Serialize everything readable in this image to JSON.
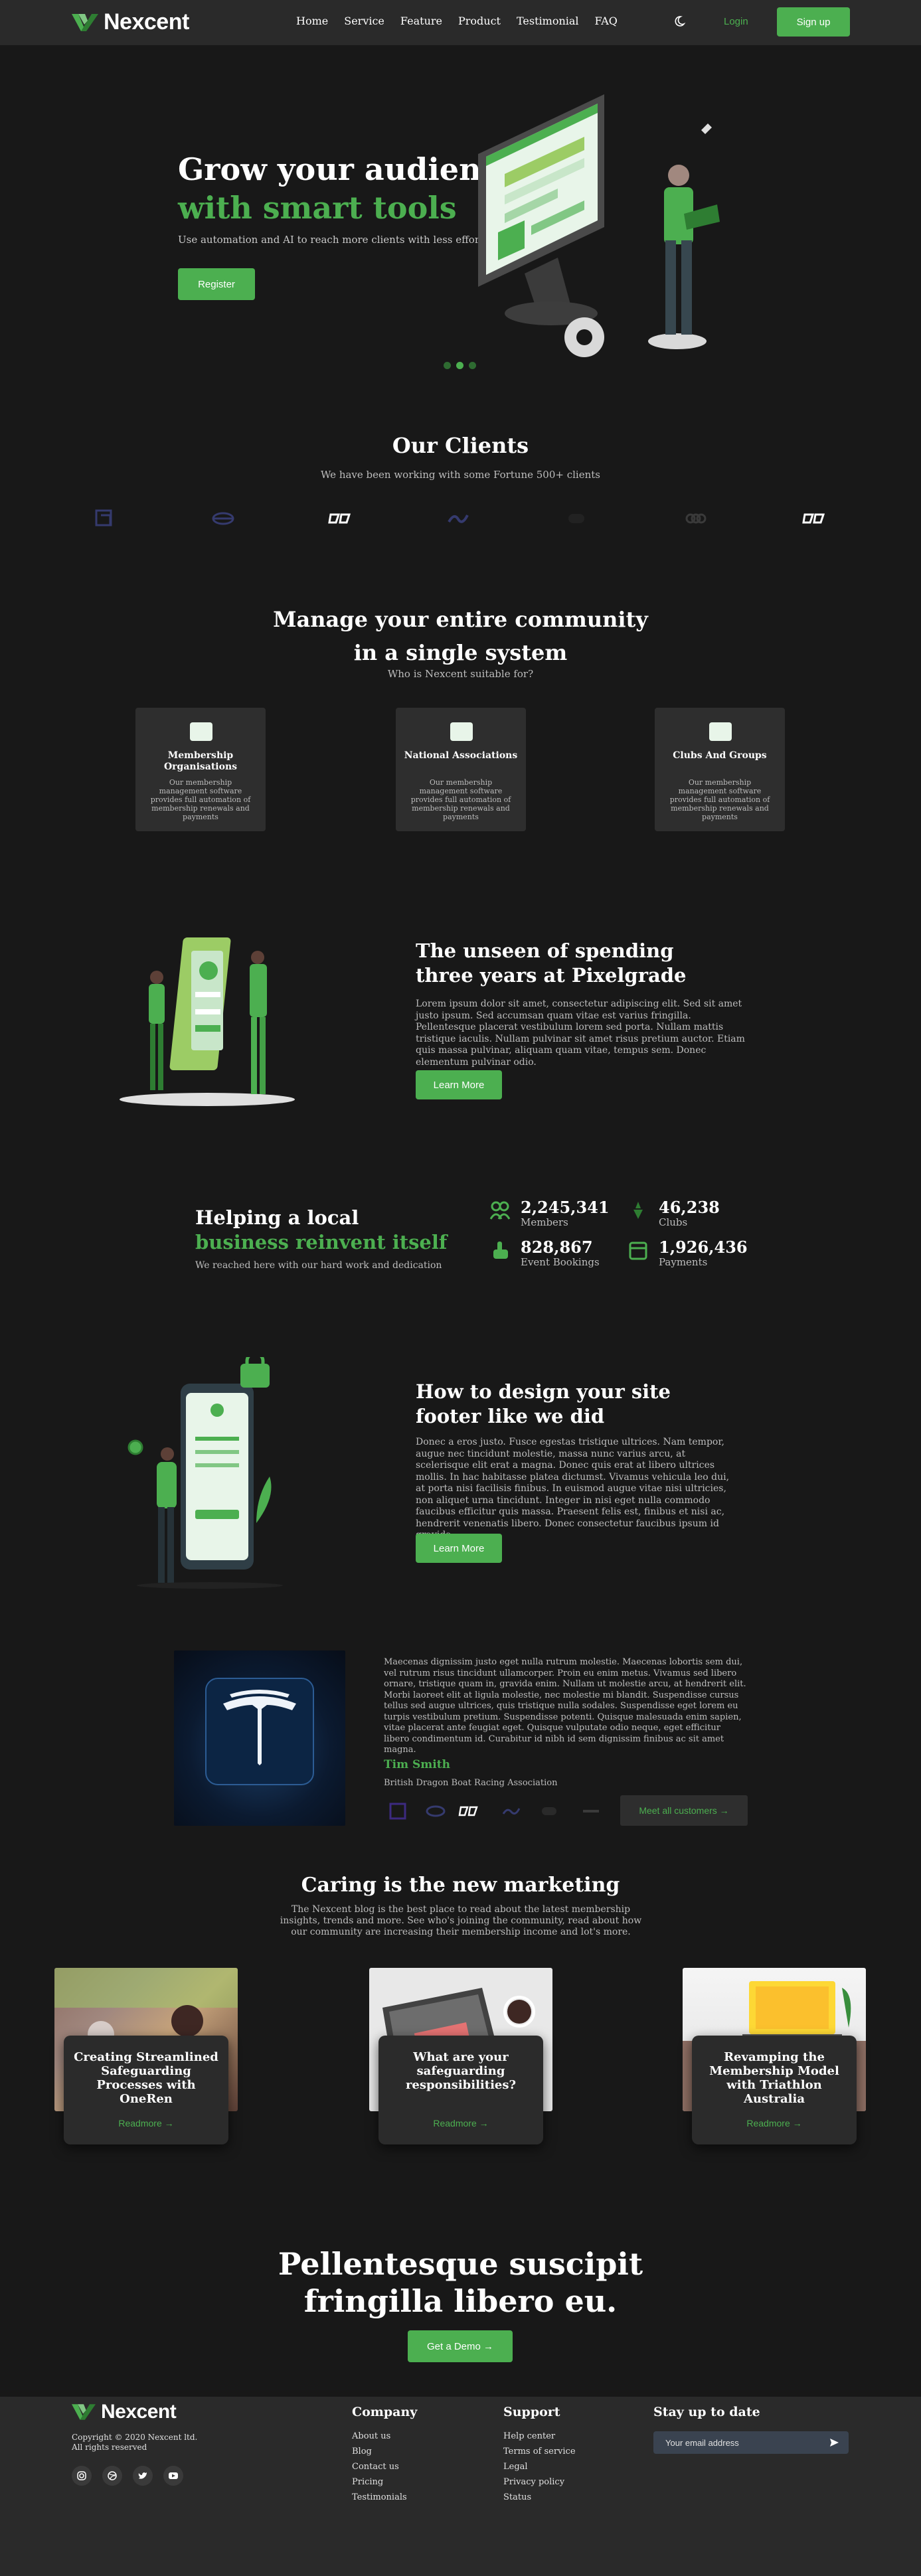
{
  "header": {
    "brand": "Nexcent",
    "nav": [
      "Home",
      "Service",
      "Feature",
      "Product",
      "Testimonial",
      "FAQ"
    ],
    "login": "Login",
    "signup": "Sign up"
  },
  "hero": {
    "title_line1": "Grow your audience",
    "title_line2": "with smart tools",
    "subtitle": "Use automation and AI to reach more clients with less effort.",
    "cta": "Register",
    "slides": 3,
    "active_slide": 2
  },
  "clients": {
    "title": "Our Clients",
    "subtitle": "We have been working with some Fortune 500+ clients"
  },
  "community": {
    "title_line1": "Manage your entire community",
    "title_line2": "in a single system",
    "subtitle": "Who is Nexcent suitable for?",
    "cards": [
      {
        "title": "Membership Organisations",
        "desc": "Our membership management software provides full automation of membership renewals and payments"
      },
      {
        "title": "National Associations",
        "desc": "Our membership management software provides full automation of membership renewals and payments"
      },
      {
        "title": "Clubs And Groups",
        "desc": "Our membership management software provides full automation of membership renewals and payments"
      }
    ]
  },
  "unseen": {
    "title": "The unseen of spending three years at Pixelgrade",
    "body": "Lorem ipsum dolor sit amet, consectetur adipiscing elit. Sed sit amet justo ipsum. Sed accumsan quam vitae est varius fringilla. Pellentesque placerat vestibulum lorem sed porta. Nullam mattis tristique iaculis. Nullam pulvinar sit amet risus pretium auctor. Etiam quis massa pulvinar, aliquam quam vitae, tempus sem. Donec elementum pulvinar odio.",
    "cta": "Learn More"
  },
  "stats": {
    "title_line1": "Helping a local",
    "title_line2": "business reinvent itself",
    "subtitle": "We reached here with our hard work and dedication",
    "items": [
      {
        "value": "2,245,341",
        "label": "Members"
      },
      {
        "value": "46,238",
        "label": "Clubs"
      },
      {
        "value": "828,867",
        "label": "Event Bookings"
      },
      {
        "value": "1,926,436",
        "label": "Payments"
      }
    ]
  },
  "footer_design": {
    "title": "How to design your site footer like we did",
    "body": "Donec a eros justo. Fusce egestas tristique ultrices. Nam tempor, augue nec tincidunt molestie, massa nunc varius arcu, at scelerisque elit erat a magna. Donec quis erat at libero ultrices mollis. In hac habitasse platea dictumst. Vivamus vehicula leo dui, at porta nisi facilisis finibus. In euismod augue vitae nisi ultricies, non aliquet urna tincidunt. Integer in nisi eget nulla commodo faucibus efficitur quis massa. Praesent felis est, finibus et nisi ac, hendrerit venenatis libero. Donec consectetur faucibus ipsum id gravida.",
    "cta": "Learn More"
  },
  "testimonial": {
    "quote": "Maecenas dignissim justo eget nulla rutrum molestie. Maecenas lobortis sem dui, vel rutrum risus tincidunt ullamcorper. Proin eu enim metus. Vivamus sed libero ornare, tristique quam in, gravida enim. Nullam ut molestie arcu, at hendrerit elit. Morbi laoreet elit at ligula molestie, nec molestie mi blandit. Suspendisse cursus tellus sed augue ultrices, quis tristique nulla sodales. Suspendisse eget lorem eu turpis vestibulum pretium. Suspendisse potenti. Quisque malesuada enim sapien, vitae placerat ante feugiat eget. Quisque vulputate odio neque, eget efficitur libero condimentum id. Curabitur id nibh id sem dignissim finibus ac sit amet magna.",
    "name": "Tim Smith",
    "org": "British Dragon Boat Racing Association",
    "more": "Meet all customers →"
  },
  "blog": {
    "title": "Caring is the new marketing",
    "subtitle": "The Nexcent blog is the best place to read about the latest membership insights, trends and more. See who's joining the community, read about how our community are increasing their membership income and lot's more.",
    "cards": [
      {
        "title": "Creating Streamlined Safeguarding Processes with OneRen",
        "link": "Readmore →"
      },
      {
        "title": "What are your safeguarding responsibilities?",
        "link": "Readmore →"
      },
      {
        "title": "Revamping the Membership Model with Triathlon Australia",
        "link": "Readmore →"
      }
    ]
  },
  "cta": {
    "title_line1": "Pellentesque suscipit",
    "title_line2": "fringilla libero eu.",
    "button": "Get a Demo →"
  },
  "footer": {
    "brand": "Nexcent",
    "copyright": "Copyright © 2020 Nexcent ltd.",
    "rights": "All rights reserved",
    "company_title": "Company",
    "company_links": [
      "About us",
      "Blog",
      "Contact us",
      "Pricing",
      "Testimonials"
    ],
    "support_title": "Support",
    "support_links": [
      "Help center",
      "Terms of service",
      "Legal",
      "Privacy policy",
      "Status"
    ],
    "newsletter_title": "Stay up to date",
    "email_placeholder": "Your email address"
  },
  "colors": {
    "accent": "#4caf50",
    "background": "#181818",
    "panel": "#2a2a2a"
  }
}
